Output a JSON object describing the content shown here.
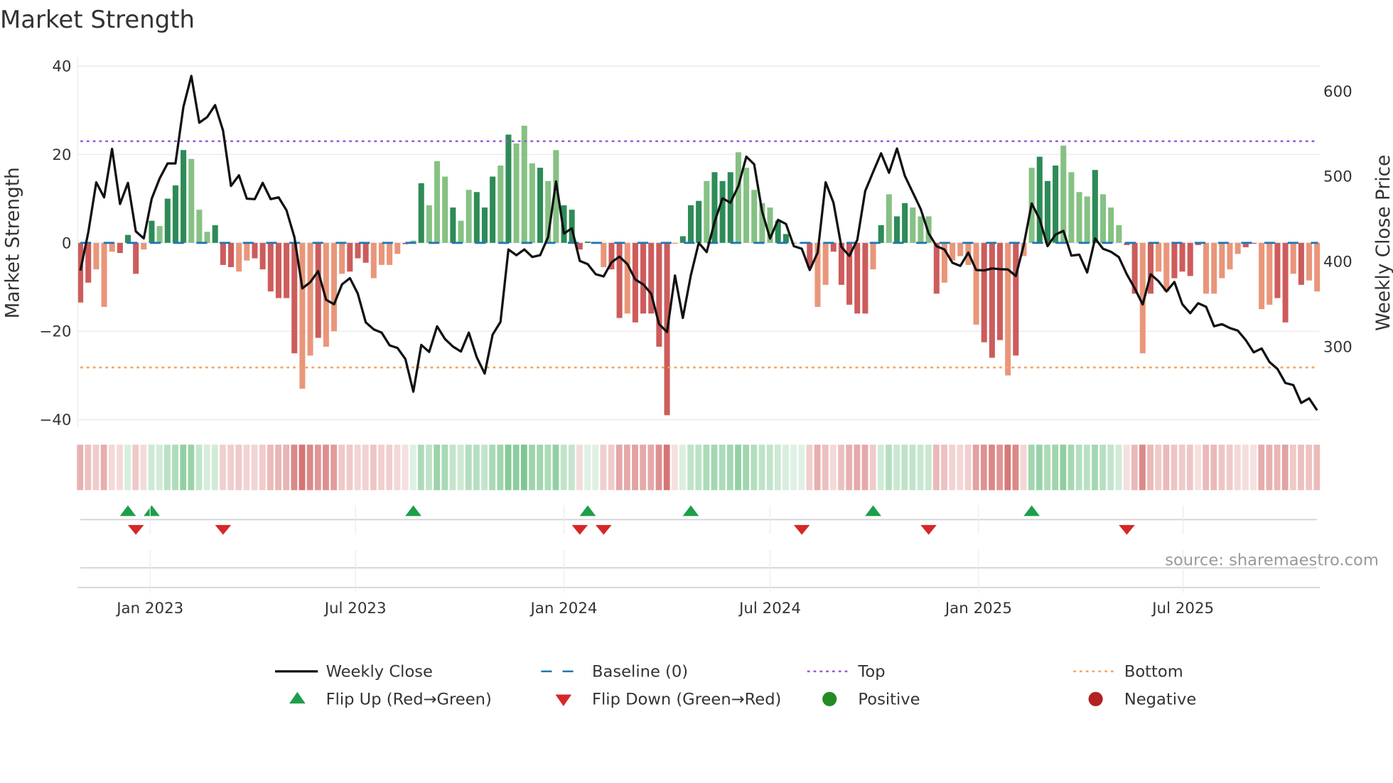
{
  "chart_data": {
    "type": "bar",
    "title": "Market Strength",
    "ylabel": "Market Strength",
    "y2label": "Weekly Close Price",
    "ylim": [
      -42,
      42
    ],
    "y2lim": [
      215,
      630
    ],
    "yticks": [
      40,
      20,
      0,
      -20,
      -40
    ],
    "ytick_labels": [
      "40",
      "20",
      "0",
      "−20",
      "−40"
    ],
    "y2ticks": [
      600,
      500,
      400,
      300
    ],
    "y2tick_labels": [
      "600",
      "500",
      "400",
      "300"
    ],
    "x_unit": "week index (0 = early Nov 2022)",
    "xticks": [
      {
        "week": 8.8,
        "label": "Jan 2023"
      },
      {
        "week": 34.7,
        "label": "Jul 2023"
      },
      {
        "week": 61.0,
        "label": "Jan 2024"
      },
      {
        "week": 87.0,
        "label": "Jul 2024"
      },
      {
        "week": 113.3,
        "label": "Jan 2025"
      },
      {
        "week": 139.1,
        "label": "Jul 2025"
      }
    ],
    "top_level": 23,
    "bottom_level": -28.2,
    "baseline": 0,
    "strength": [
      -13.5,
      -9,
      -6,
      -14.5,
      -2,
      -2.3,
      1.8,
      -7,
      -1.5,
      5,
      3.8,
      10,
      13,
      21,
      19,
      7.5,
      2.5,
      4,
      -5,
      -5.5,
      -6.5,
      -4,
      -3.5,
      -6,
      -11,
      -12.5,
      -12.5,
      -25,
      -33,
      -25.5,
      -21.5,
      -23.5,
      -20,
      -7,
      -6.5,
      -3.5,
      -4.5,
      -8,
      -5,
      -5,
      -2.5,
      -0.3,
      0.5,
      13.5,
      8.5,
      18.5,
      15,
      8,
      5,
      12,
      11.5,
      8,
      15,
      17.5,
      24.5,
      22.5,
      26.5,
      18,
      17,
      14,
      21,
      8.5,
      7.5,
      -1.5,
      0.3,
      0,
      -5.5,
      -6,
      -17,
      -16,
      -18,
      -16,
      -16,
      -23.5,
      -39,
      -0.2,
      1.5,
      8.5,
      9.5,
      14,
      16,
      14,
      16,
      20.5,
      17,
      12,
      9,
      8,
      5,
      2,
      0,
      0,
      -5.5,
      -14.5,
      -9.5,
      -2,
      -9.5,
      -14,
      -16,
      -16,
      -6,
      4,
      11,
      6,
      9,
      8,
      6,
      6,
      -11.5,
      -9,
      -4,
      -3,
      -5,
      -18.5,
      -22.5,
      -26,
      -22,
      -30,
      -25.5,
      -3,
      17,
      19.5,
      14,
      17.5,
      22,
      16,
      11.5,
      10.5,
      16.5,
      11,
      8,
      4,
      -0.5,
      -11.5,
      -25,
      -11.5,
      -6.5,
      -11,
      -8,
      -6.5,
      -7.5,
      -0.5,
      -11.5,
      -11.5,
      -8,
      -6,
      -2.5,
      -1,
      -0.2,
      -15,
      -14,
      -12.5,
      -18,
      -7,
      -9.5,
      -8.5,
      -11
    ],
    "strength_shade": "ddllldddldldddllldddllddddddlldllldddlllldldllldlldddldllldllddddllddldddddldddldddllllldddddlldddddldlddllldllllldddldlldddlllldlllddldllddddlllllddllddldl",
    "weekly_close": [
      389.4,
      434.4,
      493,
      475.4,
      532.3,
      467.6,
      492.4,
      435.5,
      427.2,
      473.8,
      497.6,
      515.2,
      515.2,
      581.5,
      617.8,
      562.9,
      569.6,
      583.6,
      553.6,
      488.8,
      501.3,
      473.8,
      473.3,
      492.4,
      473.3,
      475.4,
      460.3,
      428.7,
      368.6,
      375.9,
      388.8,
      355.2,
      350,
      373.3,
      380.6,
      362.4,
      328.8,
      320.5,
      316.8,
      301.8,
      298.7,
      285.8,
      247.4,
      302.3,
      294,
      324.1,
      309.1,
      300.3,
      294.6,
      316.8,
      287.8,
      268.7,
      314.3,
      329.3,
      414.2,
      407.5,
      414.2,
      405.4,
      407.5,
      428.7,
      494,
      432.9,
      439.1,
      400.8,
      397.1,
      385.2,
      382.6,
      399.2,
      405.9,
      397.1,
      379,
      373.3,
      362.4,
      326.7,
      317.4,
      383.7,
      333.9,
      383.7,
      422,
      411.2,
      446.6,
      474.2,
      469.1,
      488.6,
      523.1,
      514.1,
      458.6,
      427.1,
      449,
      444.2,
      418.1,
      415.1,
      390.2,
      410.6,
      493.1,
      469.1,
      417.2,
      406.7,
      425.6,
      482.6,
      505.1,
      527,
      504.2,
      532.7,
      500.6,
      481.1,
      461.6,
      433.1,
      418.1,
      414.2,
      398.6,
      395,
      410.6,
      390.2,
      389.6,
      392,
      391.1,
      390.8,
      383,
      419.6,
      468.2,
      449.6,
      418.1,
      431.6,
      436.1,
      407,
      408.2,
      387.2,
      427.1,
      415.1,
      411.5,
      405.2,
      385.1,
      368.6,
      349.7,
      385.1,
      377,
      365,
      376.1,
      350,
      339.5,
      351.2,
      347,
      324.2,
      326.6,
      322.1,
      319.1,
      308,
      293.6,
      298.1,
      282.2,
      274.1,
      257.6,
      255.2,
      234.2,
      239.6,
      225.5
    ],
    "flip_up_weeks": [
      6,
      9,
      42,
      64,
      77,
      100,
      120
    ],
    "flip_down_weeks": [
      7,
      18,
      63,
      66,
      91,
      107,
      132
    ],
    "legend": [
      {
        "label": "Weekly Close",
        "symbol": "line"
      },
      {
        "label": "Baseline (0)",
        "symbol": "dash"
      },
      {
        "label": "Top",
        "symbol": "dot-purple"
      },
      {
        "label": "Bottom",
        "symbol": "dot-orange"
      },
      {
        "label": "Flip Up (Red→Green)",
        "symbol": "triangle-up"
      },
      {
        "label": "Flip Down (Green→Red)",
        "symbol": "triangle-down"
      },
      {
        "label": "Positive",
        "symbol": "circle-green"
      },
      {
        "label": "Negative",
        "symbol": "circle-red"
      }
    ],
    "legend_placement": "bottom",
    "grid": true,
    "source": "source: sharemaestro.com",
    "colors": {
      "pos_strong": "#2e8b57",
      "pos_weak": "#86c184",
      "neg_strong": "#cd5c5c",
      "neg_weak": "#e9967a",
      "close": "#111111",
      "baseline": "#1f77b4",
      "top": "#9b59d6",
      "bottom": "#f4a460",
      "flip_up": "#1e9e4a",
      "flip_down": "#d62728",
      "positive": "#228b22",
      "negative": "#b22222"
    }
  }
}
